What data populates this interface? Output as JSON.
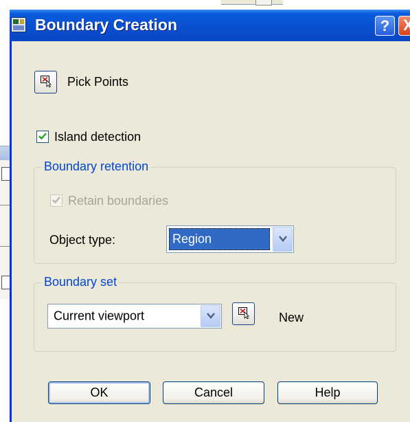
{
  "dialog": {
    "title": "Boundary Creation",
    "help_glyph": "?",
    "close_glyph": "X"
  },
  "pick_points": {
    "label": "Pick Points",
    "icon": "pick-points-icon"
  },
  "island_detection": {
    "label": "Island detection",
    "checked": true
  },
  "boundary_retention": {
    "title": "Boundary retention",
    "retain_label": "Retain boundaries",
    "retain_checked": true,
    "retain_enabled": false,
    "object_type_label": "Object type:",
    "object_type_value": "Region"
  },
  "boundary_set": {
    "title": "Boundary set",
    "value": "Current viewport",
    "new_label": "New"
  },
  "buttons": {
    "ok": "OK",
    "cancel": "Cancel",
    "help": "Help"
  },
  "colors": {
    "titlebar": "#0a4fd0",
    "dialog_bg": "#ece9d8",
    "group_title": "#0046d5",
    "selection": "#316ac5",
    "close": "#d9421c"
  }
}
